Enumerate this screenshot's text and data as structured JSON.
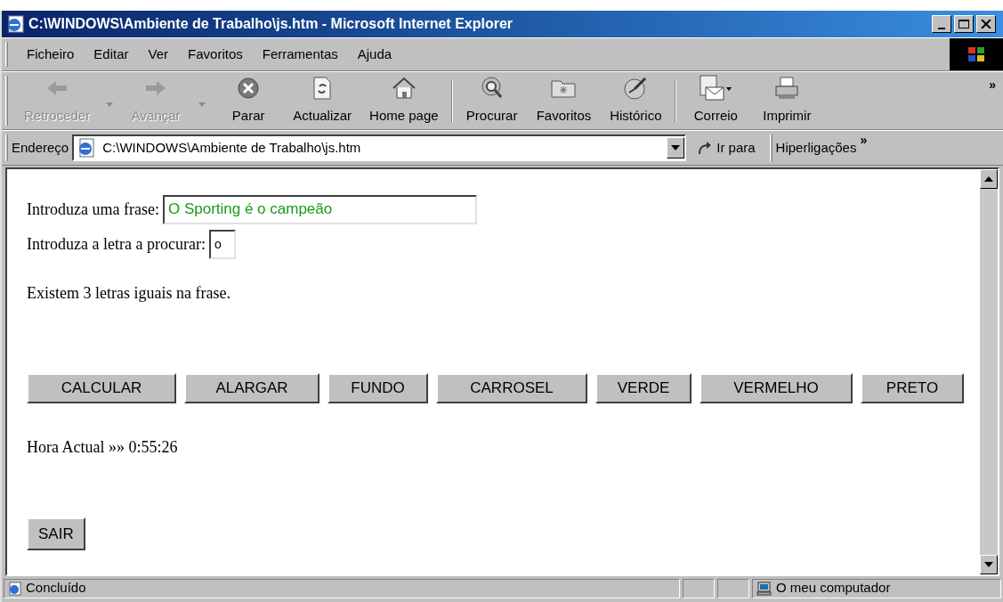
{
  "window": {
    "title": "C:\\WINDOWS\\Ambiente de Trabalho\\js.htm - Microsoft Internet Explorer"
  },
  "menu": [
    "Ficheiro",
    "Editar",
    "Ver",
    "Favoritos",
    "Ferramentas",
    "Ajuda"
  ],
  "toolbar": [
    {
      "kind": "back",
      "label": "Retroceder",
      "disabled": true
    },
    {
      "kind": "forward",
      "label": "Avançar",
      "disabled": true
    },
    {
      "kind": "stop",
      "label": "Parar",
      "disabled": false
    },
    {
      "kind": "refresh",
      "label": "Actualizar",
      "disabled": false
    },
    {
      "kind": "home",
      "label": "Home page",
      "disabled": false
    },
    {
      "kind": "search",
      "label": "Procurar",
      "disabled": false
    },
    {
      "kind": "favorites",
      "label": "Favoritos",
      "disabled": false
    },
    {
      "kind": "history",
      "label": "Histórico",
      "disabled": false
    },
    {
      "kind": "mail",
      "label": "Correio",
      "disabled": false
    },
    {
      "kind": "print",
      "label": "Imprimir",
      "disabled": false
    }
  ],
  "toolbar_more": "»",
  "address_bar": {
    "label": "Endereço",
    "value": "C:\\WINDOWS\\Ambiente de Trabalho\\js.htm",
    "go": "Ir para",
    "links": "Hiperligações",
    "links_more": "»"
  },
  "page": {
    "phrase_label": "Introduza uma frase:",
    "phrase_value": "O Sporting é o campeão",
    "letter_label": "Introduza a letra a procurar:",
    "letter_value": "o",
    "result": "Existem 3 letras iguais na frase.",
    "buttons": [
      "CALCULAR",
      "ALARGAR",
      "FUNDO",
      "CARROSEL",
      "VERDE",
      "VERMELHO",
      "PRETO"
    ],
    "clock": "Hora Actual »» 0:55:26",
    "exit_button": "SAIR"
  },
  "status_bar": {
    "status": "Concluído",
    "zone": "O meu computador"
  }
}
